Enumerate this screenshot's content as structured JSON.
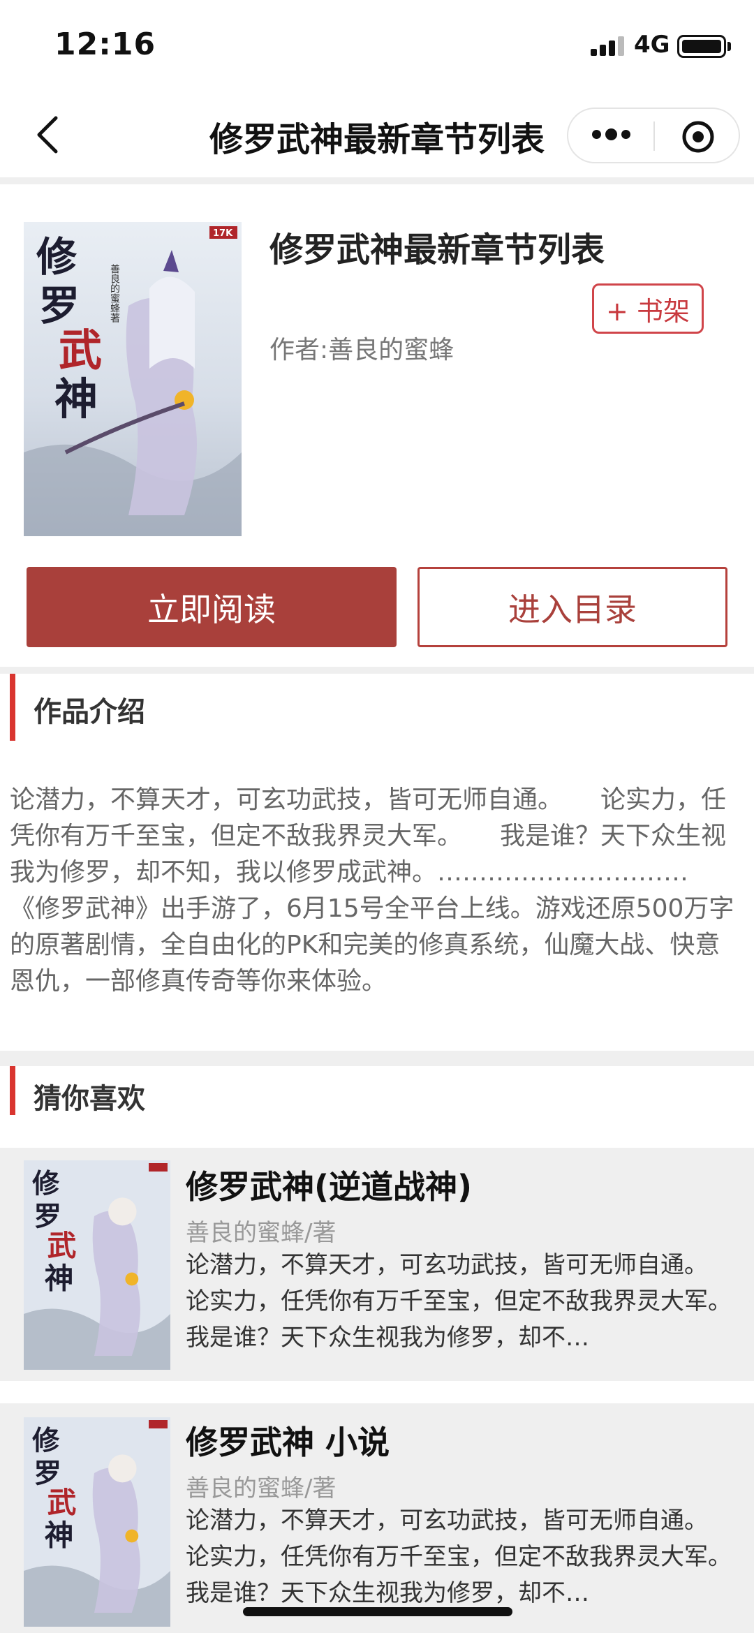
{
  "status": {
    "time": "12:16",
    "network": "4G"
  },
  "nav": {
    "title": "修罗武神最新章节列表",
    "back_icon": "chevron-left-icon",
    "more_icon": "more-dots-icon",
    "close_icon": "target-circle-icon"
  },
  "book": {
    "title": "修罗武神最新章节列表",
    "author": "作者:善良的蜜蜂",
    "shelf_label": "+ 书架",
    "read_label": "立即阅读",
    "toc_label": "进入目录",
    "cover_text": "修罗武神",
    "cover_author": "善良的蜜蜂著",
    "cover_publisher": "17K"
  },
  "intro": {
    "heading": "作品介绍",
    "text": "论潜力，不算天才，可玄功武技，皆可无师自通。　　论实力，任凭你有万千至宝，但定不敌我界灵大军。　　我是谁？天下众生视我为修罗，却不知，我以修罗成武神。…………………………　　《修罗武神》出手游了，6月15号全平台上线。游戏还原500万字的原著剧情，全自由化的PK和完美的修真系统，仙魔大战、快意恩仇，一部修真传奇等你来体验。"
  },
  "recommend": {
    "heading": "猜你喜欢",
    "items": [
      {
        "title": "修罗武神(逆道战神)",
        "author": "善良的蜜蜂/著",
        "desc": "论潜力，不算天才，可玄功武技，皆可无师自通。　　论实力，任凭你有万千至宝，但定不敌我界灵大军。　　我是谁？天下众生视我为修罗，却不…"
      },
      {
        "title": "修罗武神 小说",
        "author": "善良的蜜蜂/著",
        "desc": "论潜力，不算天才，可玄功武技，皆可无师自通。　　论实力，任凭你有万千至宝，但定不敌我界灵大军。　　我是谁？天下众生视我为修罗，却不…"
      }
    ]
  },
  "colors": {
    "accent": "#a9403b",
    "section_bar": "#d9352f",
    "band": "#efefef"
  }
}
